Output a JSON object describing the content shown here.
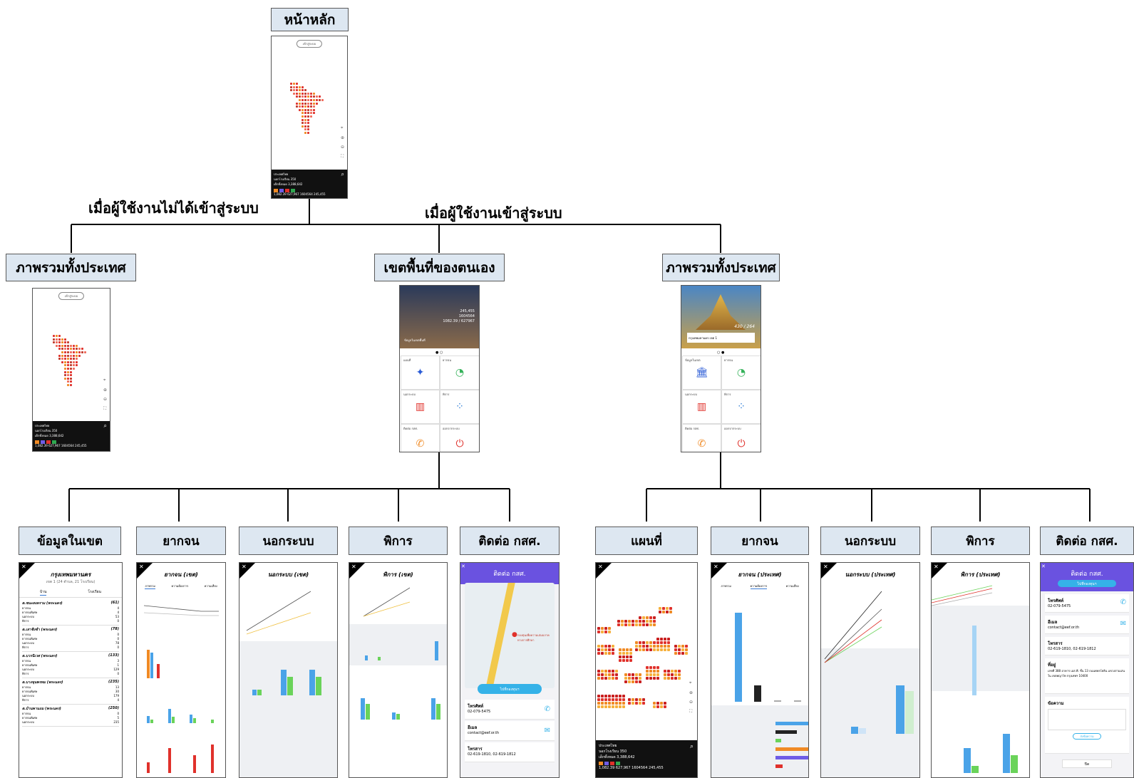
{
  "root": {
    "label": "หน้าหลัก"
  },
  "conditions": {
    "not_logged_in": "เมื่อผู้ใช้งานไม่ได้เข้าสู่ระบบ",
    "logged_in": "เมื่อผู้ใช้งานเข้าสู่ระบบ"
  },
  "level2": {
    "guest_overview": "ภาพรวมทั้งประเทศ",
    "own_area": "เขตพื้นที่ของตนเอง",
    "national_overview": "ภาพรวมทั้งประเทศ"
  },
  "own_area_children": [
    "ข้อมูลในเขต",
    "ยากจน",
    "นอกระบบ",
    "พิการ",
    "ติดต่อ กสศ."
  ],
  "national_children": [
    "แผนที่",
    "ยากจน",
    "นอกระบบ",
    "พิการ",
    "ติดต่อ กสศ."
  ],
  "screens": {
    "map_pill": "เข้าสู่ระบบ",
    "map_bottom": {
      "line1": "ประเทศไทย",
      "line2": "นอกโรงเรียน 350",
      "line3": "เด็กทั้งหมด 3,388,642",
      "values": [
        "1,082.39",
        "627,967",
        "1604564",
        "245,455"
      ]
    },
    "area_district": {
      "title": "กรุงเทพมหานคร",
      "subtitle": "เขต 1 (24 ตำบล, 21 โรงเรียน)",
      "tab_left": "บ้าน",
      "tab_right": "โรงเรียน",
      "groups": [
        {
          "name": "ต.ชนะสงคราม (พระนคร)",
          "total": "(61)",
          "rows": [
            [
              "ยากจน",
              "4"
            ],
            [
              "ยากจนพิเศษ",
              "4"
            ],
            [
              "นอกระบบ",
              "53"
            ],
            [
              "พิการ",
              "0"
            ]
          ]
        },
        {
          "name": "ต.เสาชิงช้า (พระนคร)",
          "total": "(78)",
          "rows": [
            [
              "ยากจน",
              "0"
            ],
            [
              "ยากจนพิเศษ",
              "0"
            ],
            [
              "นอกระบบ",
              "78"
            ],
            [
              "พิการ",
              "0"
            ]
          ]
        },
        {
          "name": "ต.บวรนิเวศ (พระนคร)",
          "total": "(133)",
          "rows": [
            [
              "ยากจน",
              "3"
            ],
            [
              "ยากจนพิเศษ",
              "1"
            ],
            [
              "นอกระบบ",
              "129"
            ],
            [
              "พิการ",
              "0"
            ]
          ]
        },
        {
          "name": "ต.บางขุนพรหม (พระนคร)",
          "total": "(235)",
          "rows": [
            [
              "ยากจน",
              "13"
            ],
            [
              "ยากจนพิเศษ",
              "30"
            ],
            [
              "นอกระบบ",
              "179"
            ],
            [
              "พิการ",
              "4"
            ]
          ]
        },
        {
          "name": "ต.บ้านพานถม (พระนคร)",
          "total": "(250)",
          "rows": [
            [
              "ยากจน",
              "0"
            ],
            [
              "ยากจนพิเศษ",
              "5"
            ],
            [
              "นอกระบบ",
              "235"
            ]
          ]
        }
      ]
    },
    "poor_district": {
      "title": "ยากจน (เขต)",
      "tabs": [
        "ภาพรวม",
        "ความต้องการ",
        "ความเสี่ยง"
      ]
    },
    "oos_district": {
      "title": "นอกระบบ (เขต)"
    },
    "dis_district": {
      "title": "พิการ (เขต)"
    },
    "contact": {
      "title": "ติดต่อ กสศ.",
      "map_label": "กองทุนเพื่อความเสมอภาคทางการศึกษา",
      "button": "ไปที่กองทุนฯ",
      "phone_label": "โทรศัพท์",
      "phone": "02-079-5475",
      "email_label": "อีเมล",
      "email": "contact@eef.or.th",
      "fax_label": "โทรสาร",
      "fax": "02-619-1810, 02-619-1812",
      "address_label": "ที่อยู่",
      "address": "เลขที่ 388 อาคาร เอส.พี. ชั้น 13 ถนนพหลโยธิน แขวงสามเสนใน เขตพญาไท กรุงเทพฯ 10400",
      "message_label": "ข้อความ",
      "send": "ส่งข้อความ",
      "close": "ปิด"
    },
    "poor_national": {
      "title": "ยากจน (ประเทศ)",
      "tabs": [
        "ภาพรวม",
        "ความต้องการ",
        "ความเสี่ยง"
      ]
    },
    "oos_national": {
      "title": "นอกระบบ (ประเทศ)"
    },
    "dis_national": {
      "title": "พิการ (ประเทศ)"
    },
    "menu_area": {
      "hero_stat1": "245,455",
      "hero_stat2": "1604564",
      "hero_stat3": "1082.39 / 627967",
      "hero_caption": "ข้อมูลในเขตพื้นที่",
      "tiles": [
        "แผนที่",
        "ยากจน",
        "นอกระบบ",
        "พิการ",
        "ติดต่อ กสศ.",
        "ออกจากระบบ"
      ]
    },
    "menu_national": {
      "hero_stat": "430 / 264",
      "hero_caption": "กรุงเทพมหานคร เขต 1",
      "tiles": [
        "ข้อมูลในเขต",
        "ยากจน",
        "นอกระบบ",
        "พิการ",
        "ติดต่อ กสศ.",
        "ออกจากระบบ"
      ]
    }
  },
  "colors": {
    "label_fill": "#dde7f1",
    "poor": "#f08a24",
    "special_poor": "#6e5ce6",
    "oos": "#e0312b",
    "disabled": "#2fa84f",
    "bar_blue": "#4aa3e8",
    "bar_green": "#6ad35a",
    "contact_purple": "#6a52e0"
  }
}
